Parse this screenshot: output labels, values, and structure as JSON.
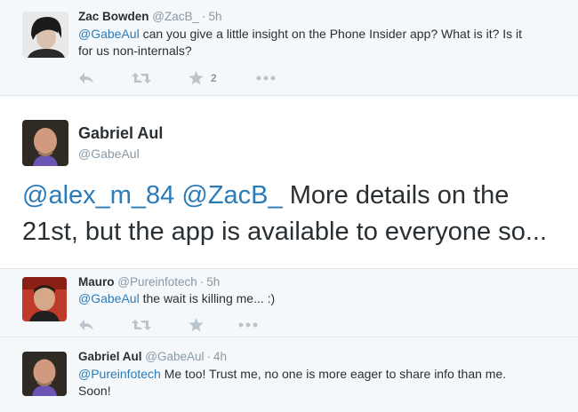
{
  "tweets": [
    {
      "name": "Zac Bowden",
      "handle": "@ZacB_",
      "time": "5h",
      "mention": "@GabeAul",
      "text_line1": " can you give a little insight on the Phone Insider app? What is it? Is it",
      "text_line2": "for us non-internals?",
      "favorite_count": "2"
    },
    {
      "name": "Gabriel Aul",
      "handle": "@GabeAul",
      "mention1": "@alex_m_84",
      "mention2": "@ZacB_",
      "text_line1": " More details on the",
      "text_line2": "21st, but the app is available to everyone so..."
    },
    {
      "name": "Mauro",
      "handle": "@Pureinfotech",
      "time": "5h",
      "mention": "@GabeAul",
      "text": " the wait is killing me... :)"
    },
    {
      "name": "Gabriel Aul",
      "handle": "@GabeAul",
      "time": "4h",
      "mention": "@Pureinfotech",
      "text_line1": " Me too! Trust me, no one is more eager to share info than me.",
      "text_line2": "Soon!"
    }
  ],
  "separator": "·",
  "icons": {
    "reply": "reply-icon",
    "retweet": "retweet-icon",
    "favorite": "star-icon",
    "more": "more-icon"
  },
  "colors": {
    "link": "#2b7bb9",
    "muted": "#8899a6",
    "action": "#b9c4cc",
    "background": "#f5f8fa"
  }
}
